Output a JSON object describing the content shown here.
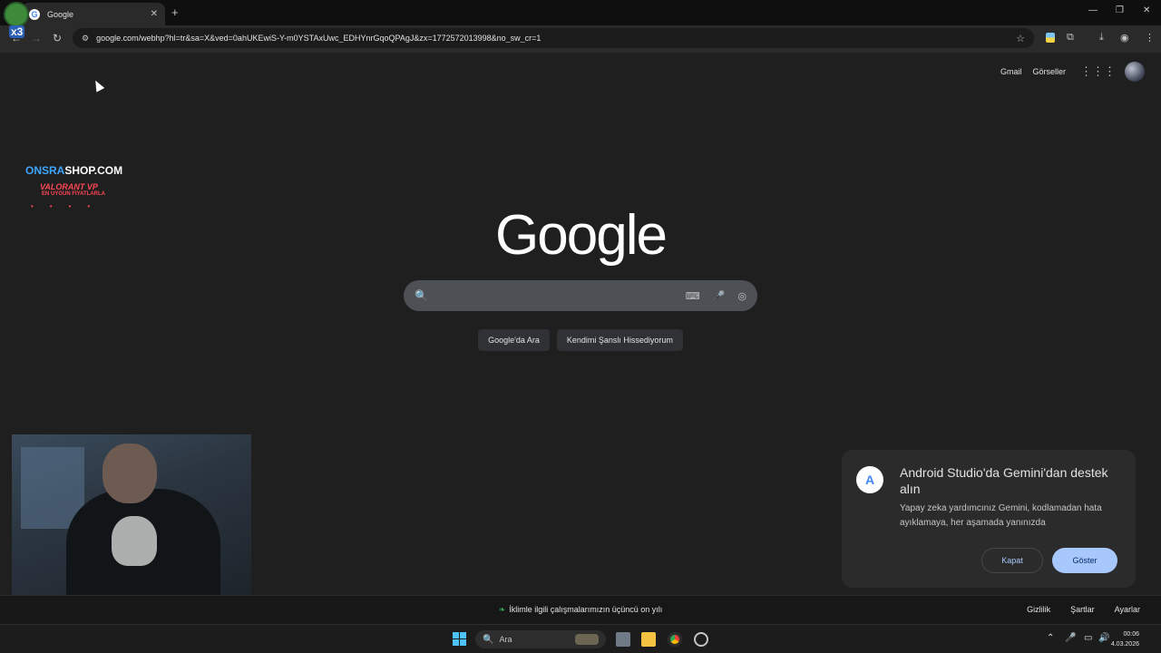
{
  "browser": {
    "tab_title": "Google",
    "tab_favicon": "G",
    "tab_close": "✕",
    "new_tab": "+",
    "window_controls": {
      "minimize": "—",
      "restore": "❐",
      "close": "✕"
    },
    "url": "google.com/webhp?hl=tr&sa=X&ved=0ahUKEwiS-Y-m0YSTAxUwc_EDHYnrGqoQPAgJ&zx=1772572013998&no_sw_cr=1",
    "nav": {
      "back": "←",
      "forward": "→",
      "reload": "↻"
    },
    "icons": {
      "site_info": "⚙",
      "bookmark": "☆",
      "extensions": "⧉",
      "download": "⤓",
      "profile": "◉",
      "menu": "⋮"
    }
  },
  "overlay": {
    "pepe_badge": "x3",
    "shop_name_part1": "ONSRA",
    "shop_name_part2": "SHOP.COM",
    "shop_line1": "VALORANT VP",
    "shop_line2": "EN UYGUN FİYATLARLA",
    "shop_dots": "••••"
  },
  "header": {
    "gmail": "Gmail",
    "images": "Görseller",
    "apps_icon": "⋮⋮⋮"
  },
  "logo": "Google",
  "search": {
    "placeholder": "",
    "search_icon": "🔍",
    "keyboard_icon": "⌨",
    "mic_icon": "🎤",
    "lens_icon": "◎"
  },
  "buttons": {
    "search": "Google'da Ara",
    "lucky": "Kendimi Şanslı Hissediyorum"
  },
  "footer": {
    "center": "İklimle ilgili çalışmalarımızın üçüncü on yılı",
    "leaf_icon": "❧",
    "privacy": "Gizlilik",
    "terms": "Şartlar",
    "settings": "Ayarlar"
  },
  "popup": {
    "icon": "A",
    "title": "Android Studio'da Gemini'dan destek alın",
    "body": "Yapay zeka yardımcınız Gemini, kodlamadan hata ayıklamaya, her aşamada yanınızda",
    "close": "Kapat",
    "show": "Göster"
  },
  "taskbar": {
    "search_label": "Ara",
    "search_icon": "🔍",
    "tray_up": "⌃",
    "mic": "🎤",
    "display": "▭",
    "volume": "🔊",
    "time": "00:06",
    "date": "4.03.2026",
    "colors": {
      "start": "#4cc2ff"
    }
  }
}
